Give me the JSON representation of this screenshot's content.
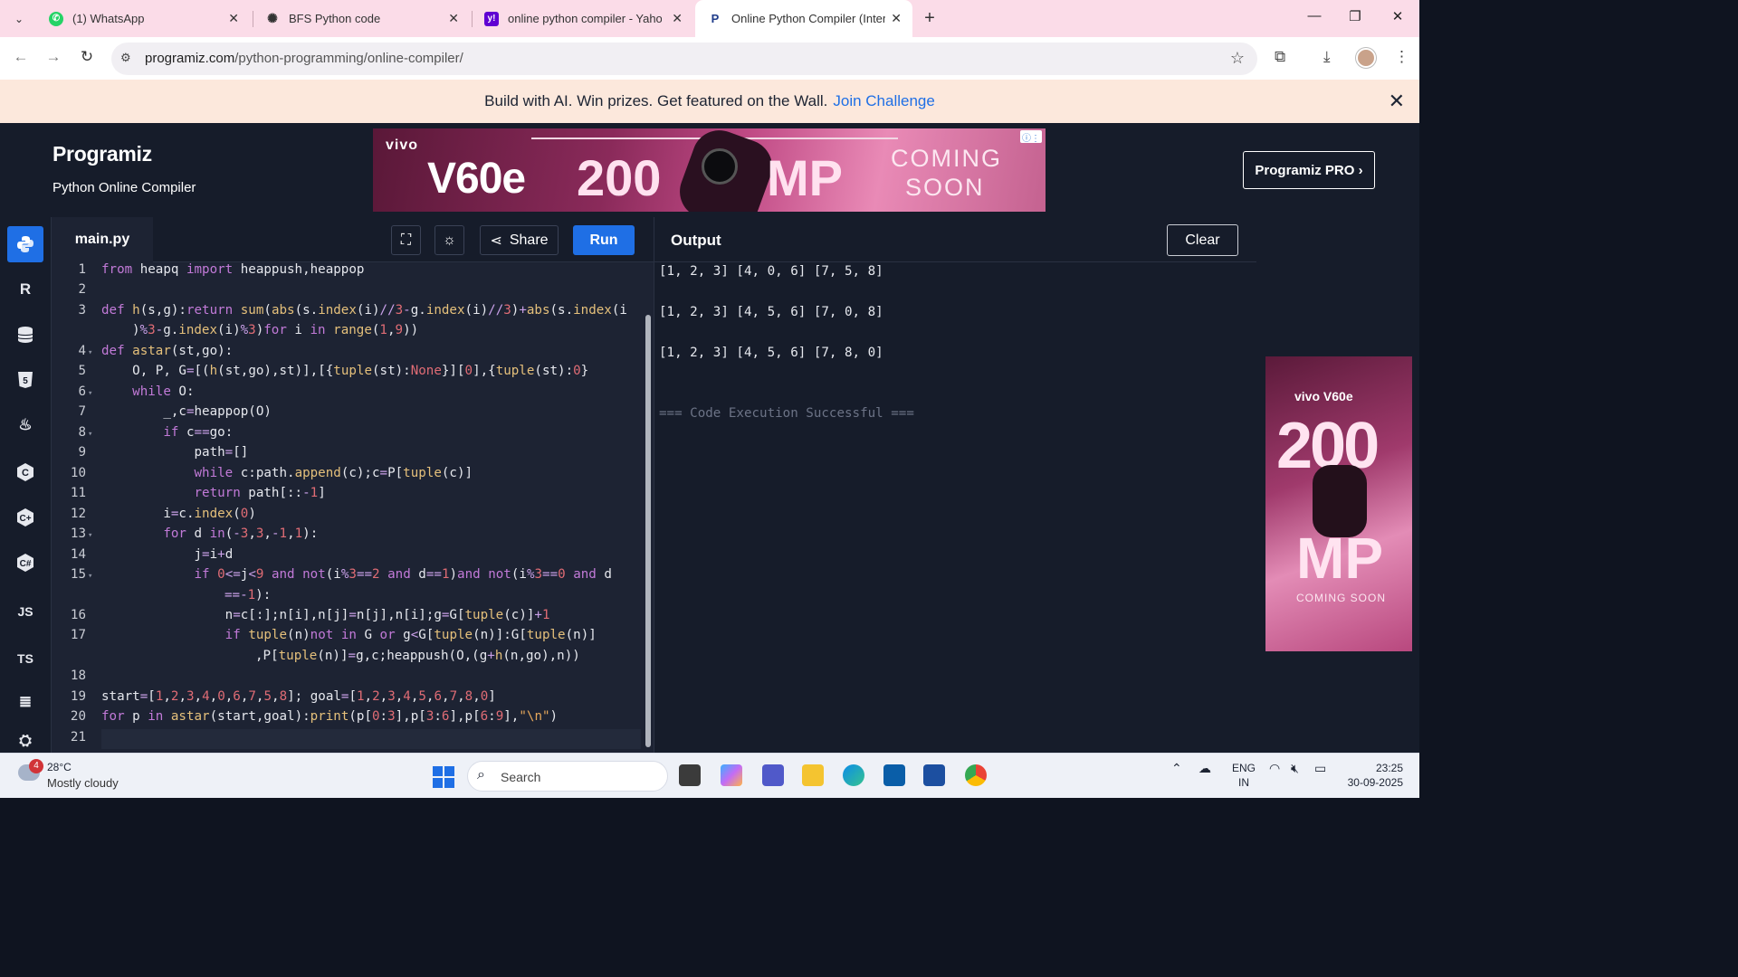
{
  "browser": {
    "tabs": [
      {
        "label": "(1) WhatsApp",
        "icon": "whatsapp-icon",
        "active": false
      },
      {
        "label": "BFS Python code",
        "icon": "chatgpt-icon",
        "active": false
      },
      {
        "label": "online python compiler - Yahoo",
        "icon": "yahoo-icon",
        "active": false
      },
      {
        "label": "Online Python Compiler (Interp",
        "icon": "programiz-icon",
        "active": true
      }
    ],
    "url_domain": "programiz.com",
    "url_path": "/python-programming/online-compiler/"
  },
  "promo": {
    "text": "Build with AI. Win prizes. Get featured on the Wall.",
    "link": "Join Challenge"
  },
  "header": {
    "logo": "Programiz",
    "subtitle": "Python Online Compiler",
    "pro_button": "Programiz PRO ›"
  },
  "ad_banner": {
    "brand": "vivo",
    "model": "V60e",
    "megapixels": "200",
    "mp": "MP",
    "coming": "COMING",
    "soon": "SOON"
  },
  "sidebar": {
    "items": [
      {
        "name": "python",
        "label": "Py",
        "active": true
      },
      {
        "name": "r",
        "label": "R",
        "active": false
      },
      {
        "name": "sql",
        "label": "DB",
        "active": false
      },
      {
        "name": "html",
        "label": "5",
        "active": false
      },
      {
        "name": "java",
        "label": "J",
        "active": false
      },
      {
        "name": "c",
        "label": "C",
        "active": false
      },
      {
        "name": "cpp",
        "label": "C",
        "active": false
      },
      {
        "name": "csharp",
        "label": "C",
        "active": false
      },
      {
        "name": "javascript",
        "label": "JS",
        "active": false
      },
      {
        "name": "typescript",
        "label": "TS",
        "active": false
      },
      {
        "name": "go",
        "label": "≡",
        "active": false
      }
    ]
  },
  "editor": {
    "file_name": "main.py",
    "share_label": "Share",
    "run_label": "Run",
    "line_numbers": [
      "1",
      "2",
      "3",
      "",
      "4",
      "5",
      "6",
      "7",
      "8",
      "9",
      "10",
      "11",
      "12",
      "13",
      "14",
      "15",
      "",
      "16",
      "17",
      "",
      "18",
      "19",
      "20",
      "21"
    ]
  },
  "output": {
    "title": "Output",
    "clear_label": "Clear",
    "lines": [
      "[1, 2, 3] [4, 0, 6] [7, 5, 8]",
      "[1, 2, 3] [4, 5, 6] [7, 0, 8]",
      "[1, 2, 3] [4, 5, 6] [7, 8, 0]"
    ],
    "status": "=== Code Execution Successful ==="
  },
  "right_ad": {
    "brand": "vivo V60e",
    "big": "200",
    "mp": "MP",
    "soon": "COMING SOON"
  },
  "taskbar": {
    "weather_alert": "4",
    "temperature": "28°C",
    "condition": "Mostly cloudy",
    "search_label": "Search",
    "lang": "ENG",
    "region": "IN",
    "time": "23:25",
    "date": "30-09-2025"
  }
}
